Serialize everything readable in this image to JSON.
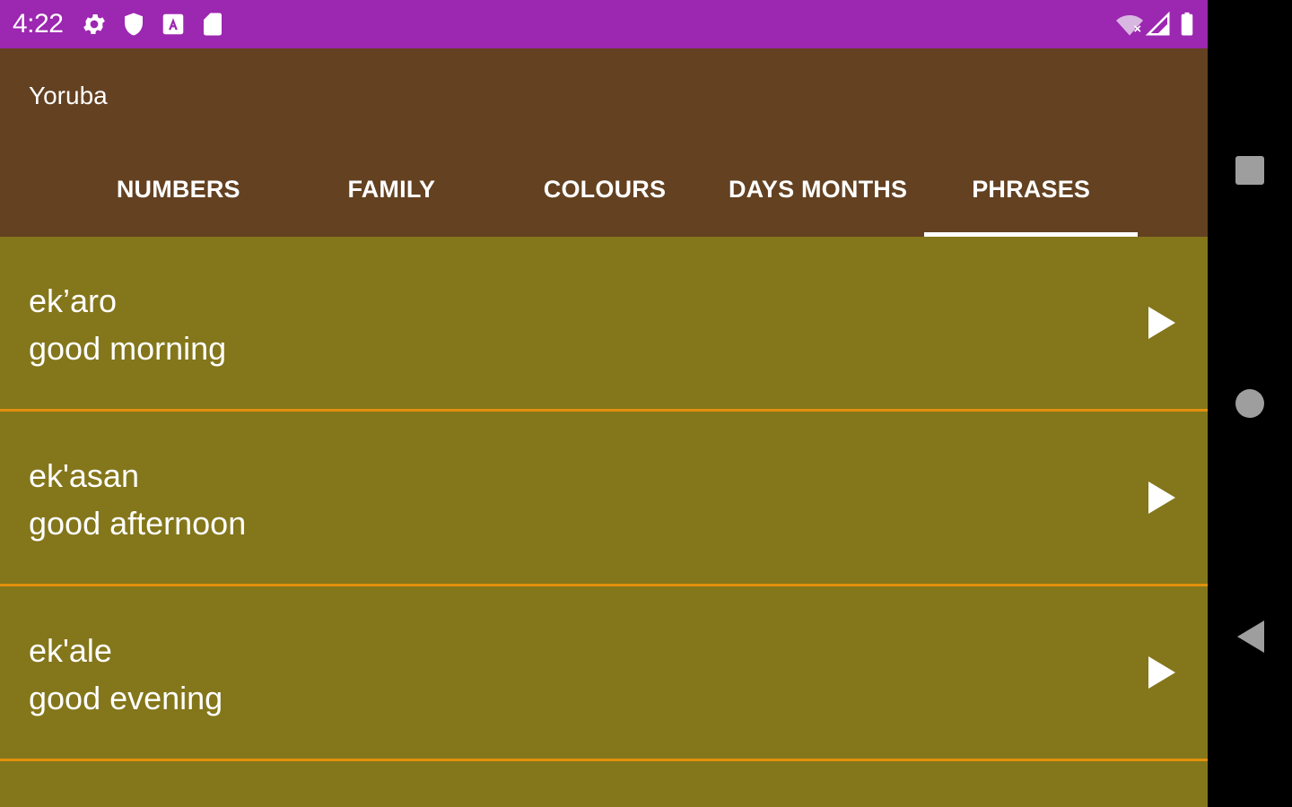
{
  "status_bar": {
    "time": "4:22",
    "icons_left": [
      "gear-icon",
      "shield-icon",
      "a-box-icon",
      "sd-card-icon"
    ],
    "icons_right": [
      "wifi-off-icon",
      "cell-signal-icon",
      "battery-icon"
    ],
    "color": "#9c27b0"
  },
  "app_bar": {
    "title": "Yoruba",
    "color": "#634121"
  },
  "tabs": [
    {
      "label": "NUMBERS",
      "selected": false
    },
    {
      "label": "FAMILY",
      "selected": false
    },
    {
      "label": "COLOURS",
      "selected": false
    },
    {
      "label": "DAYS MONTHS",
      "selected": false
    },
    {
      "label": "PHRASES",
      "selected": true
    }
  ],
  "phrases": [
    {
      "yoruba": "ek’aro",
      "english": "good morning"
    },
    {
      "yoruba": "ek'asan",
      "english": "good afternoon"
    },
    {
      "yoruba": "ek'ale",
      "english": "good evening"
    }
  ],
  "list_color": "#84761b",
  "divider_color": "#e1900c",
  "nav_bar": {
    "buttons": [
      "recents-square-icon",
      "home-circle-icon",
      "back-triangle-icon"
    ]
  }
}
